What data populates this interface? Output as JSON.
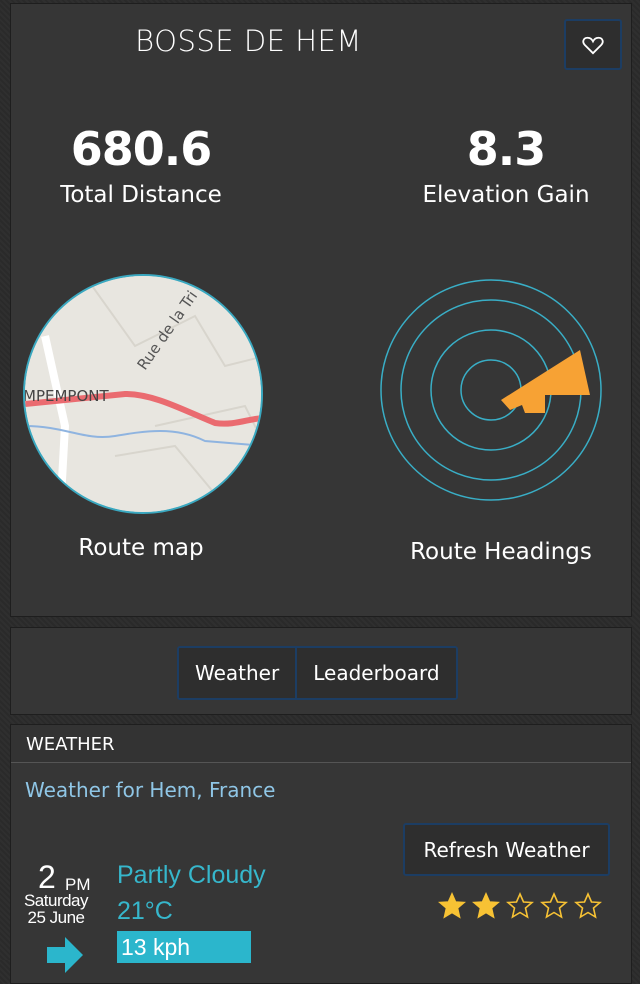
{
  "header": {
    "title": "BOSSE DE HEM",
    "favorite_icon": "heart-icon"
  },
  "stats": {
    "distance": {
      "value": "680.6",
      "label": "Total Distance"
    },
    "elevation": {
      "value": "8.3",
      "label": "Elevation Gain"
    }
  },
  "map": {
    "label": "Route map",
    "place_label": "MPEMPONT",
    "street_label": "Rue de la Tri"
  },
  "headings": {
    "label": "Route Headings",
    "accent_color": "#f7a234",
    "ring_color": "#39aec6"
  },
  "tabs": {
    "items": [
      {
        "label": "Weather"
      },
      {
        "label": "Leaderboard"
      }
    ]
  },
  "weather": {
    "section_title": "WEATHER",
    "location_link": "Weather for Hem, France",
    "refresh_label": "Refresh Weather",
    "hour": "2",
    "ampm": "PM",
    "day": "Saturday",
    "date": "25 June",
    "condition": "Partly Cloudy",
    "temperature": "21°C",
    "wind": "13 kph",
    "rating": {
      "value": 2,
      "max": 5,
      "star_color": "#f7c234"
    }
  }
}
